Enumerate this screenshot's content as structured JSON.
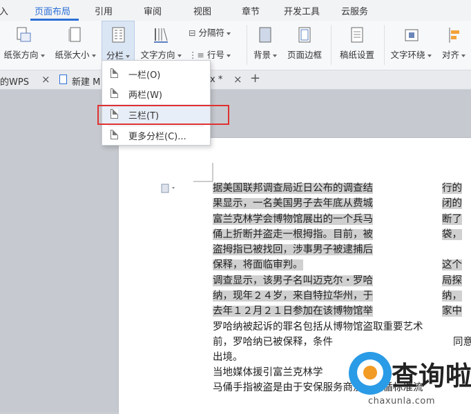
{
  "menu": {
    "tabs": [
      "入",
      "页面布局",
      "引用",
      "审阅",
      "视图",
      "章节",
      "开发工具",
      "云服务"
    ],
    "active_index": 1,
    "accent_color": "#2b6fd6"
  },
  "ribbon": {
    "paper_orientation": "纸张方向",
    "paper_size": "纸张大小",
    "columns": "分栏",
    "text_direction": "文字方向",
    "separator": "分隔符",
    "line_number": "行号",
    "background": "背景",
    "page_border": "页面边框",
    "manuscript_settings": "稿纸设置",
    "text_wrap": "文字环绕",
    "align": "对齐"
  },
  "doc_tabs": {
    "tab1": "的WPS",
    "tab2": "新建 M",
    "tab3": "x *",
    "add": "+",
    "close": "×"
  },
  "columns_menu": {
    "items": [
      "一栏(O)",
      "两栏(W)",
      "三栏(T)",
      "更多分栏(C)..."
    ],
    "highlighted_index": 2,
    "highlight_color": "#e03030"
  },
  "document": {
    "col1": [
      "据美国联邦调查局近日公布的调查结",
      "果显示，一名美国男子去年底从费城",
      "富兰克林学会博物馆展出的一个兵马",
      "俑上折断并盗走一根拇指。目前，被",
      "盗拇指已被找回，涉事男子被逮捕后",
      "保释，将面临审判。",
      "调查显示，该男子名叫迈克尔・罗哈",
      "纳，现年２４岁，来自特拉华州，于",
      "去年１２月２１日参加在该博物馆举"
    ],
    "col2": [
      "行的",
      "闭的",
      "断了",
      "袋，",
      "",
      "这个",
      "局探",
      "纳，",
      "家中"
    ],
    "full_lines": [
      "罗哈纳被起诉的罪名包括从博物馆盗取重要艺术",
      "前，罗哈纳已被保释，条件",
      "出境。",
      "当地媒体援引富兰克林学",
      "马俑手指被盗是由于安保服务商没有遵循标准流"
    ],
    "line2_tail": "同意"
  },
  "watermark": {
    "name": "查询啦",
    "domain": "chaxunla.com"
  }
}
